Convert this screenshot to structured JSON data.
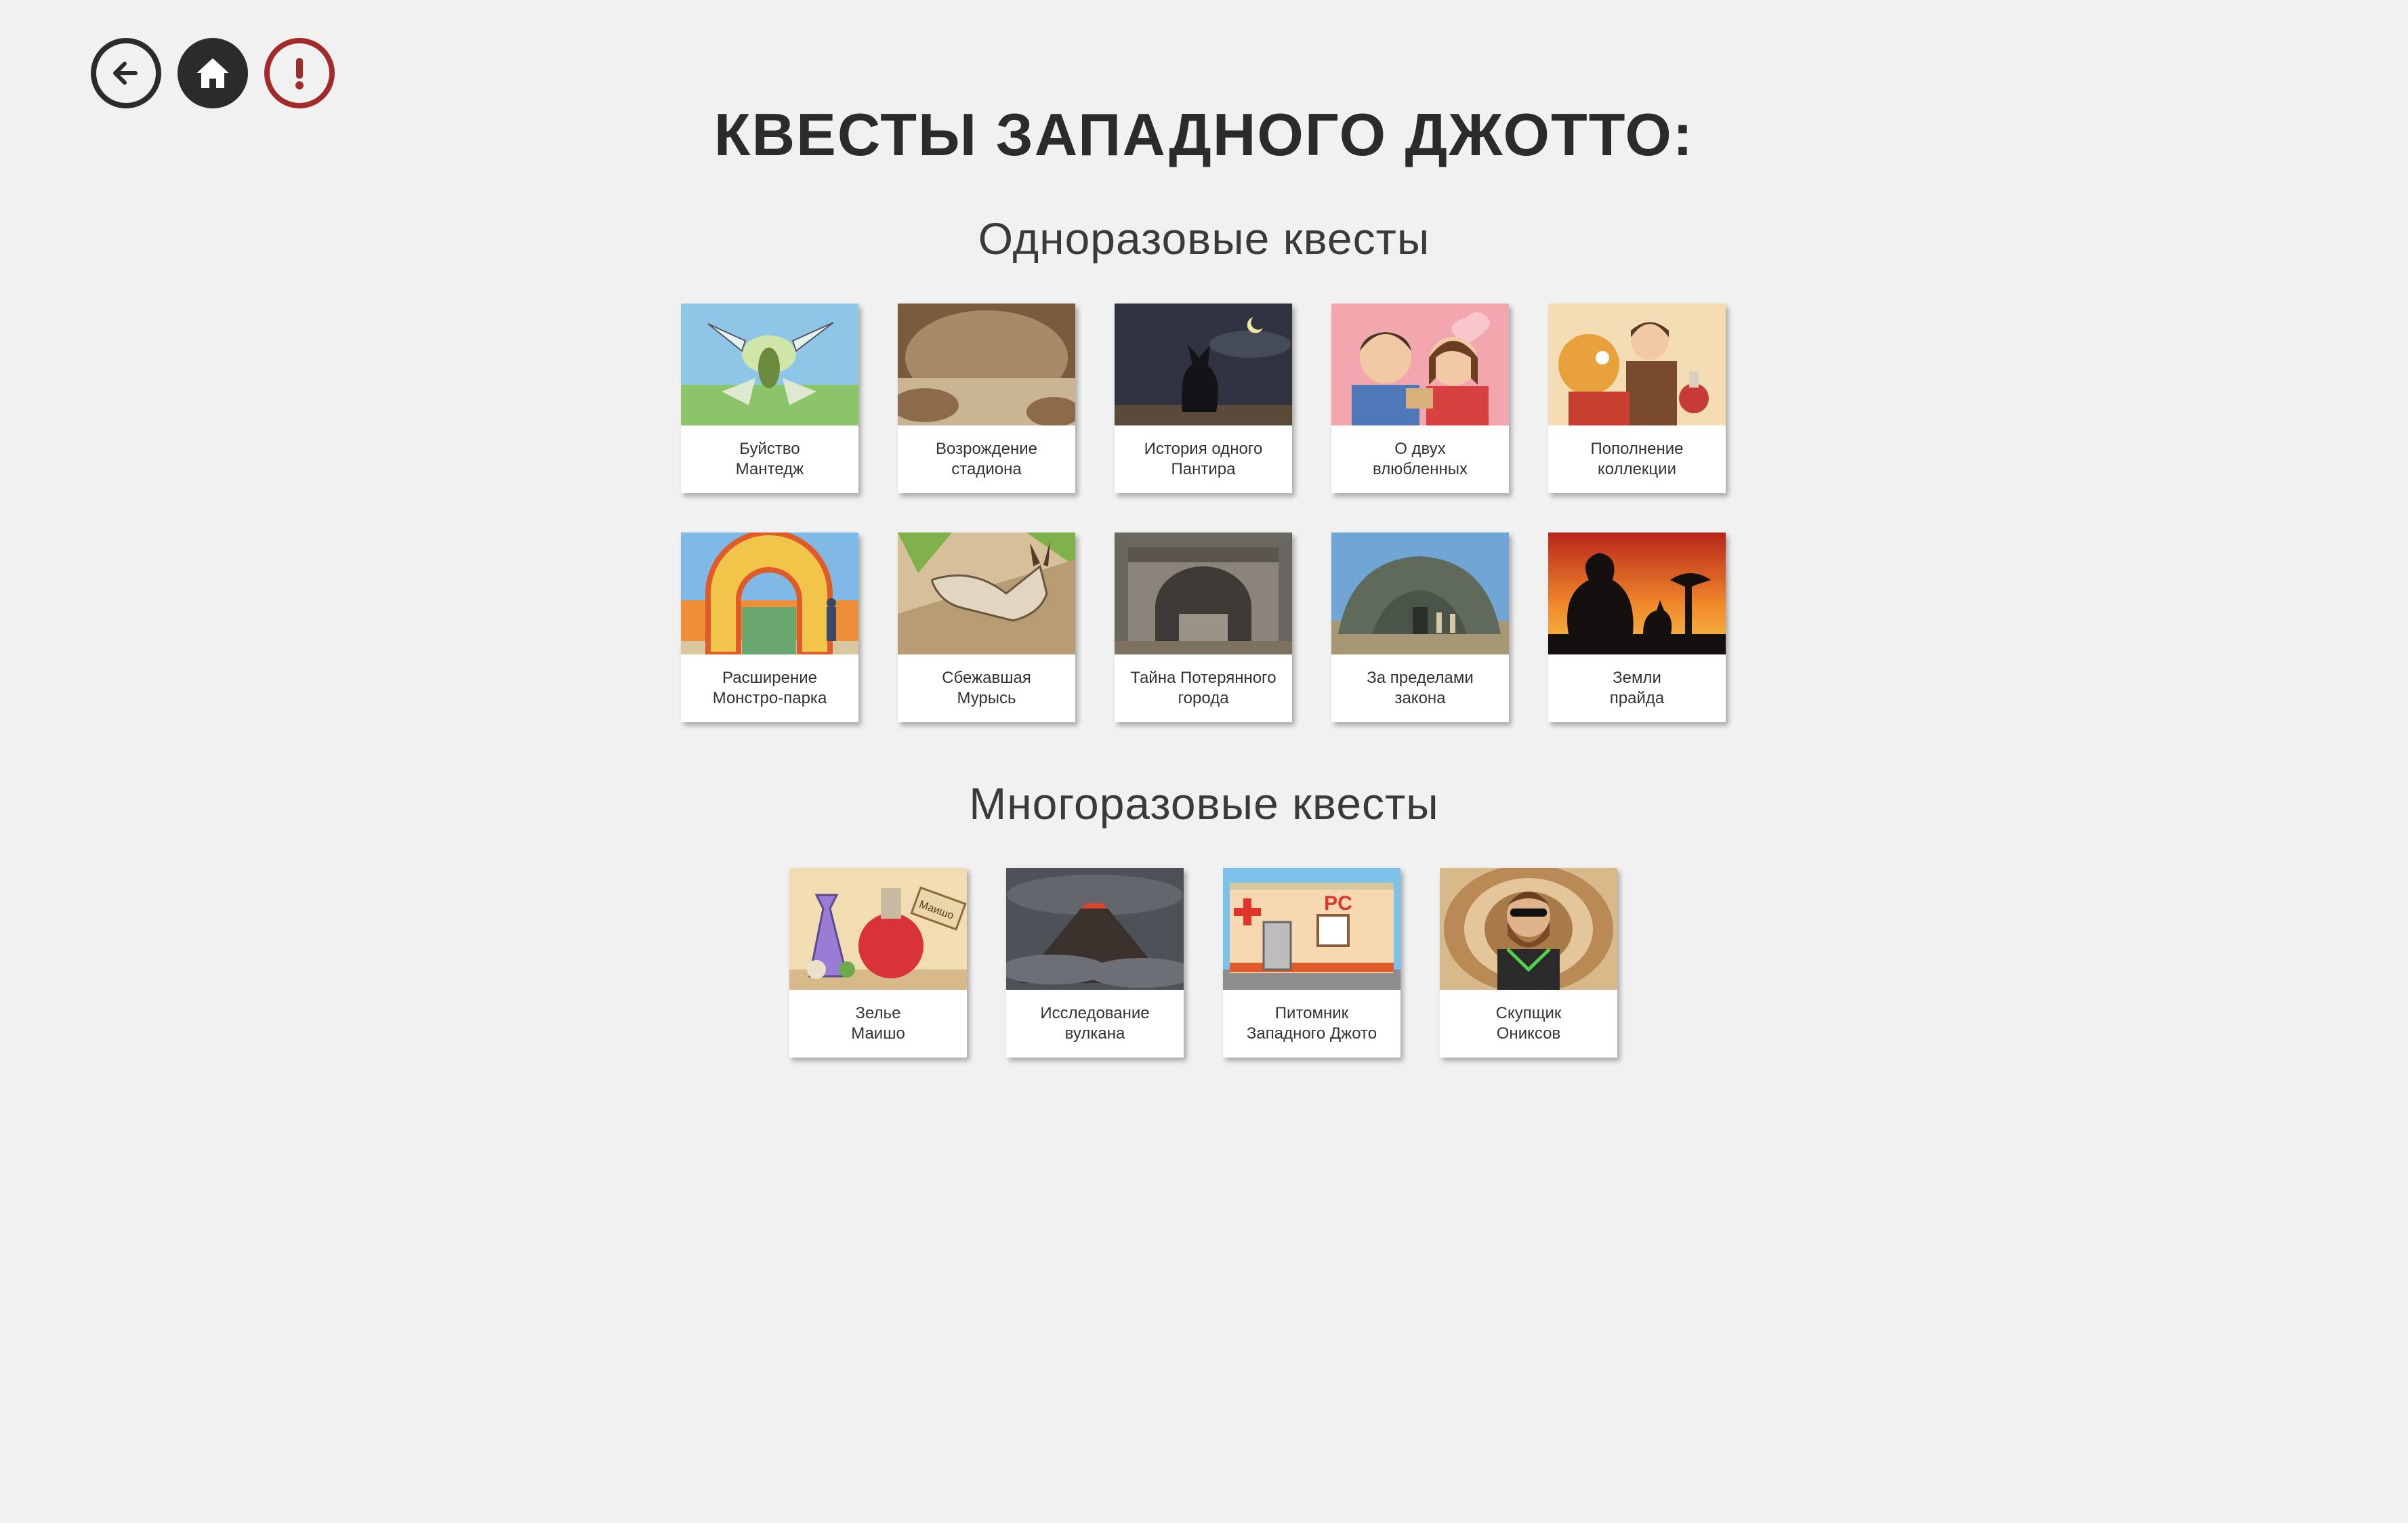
{
  "nav": {
    "back_icon": "arrow-left-icon",
    "home_icon": "home-icon",
    "alert_icon": "exclamation-icon",
    "alert_color": "#a22a2a"
  },
  "page": {
    "title": "КВЕСТЫ ЗАПАДНОГО ДЖОТТО:"
  },
  "sections": [
    {
      "title": "Одноразовые квесты",
      "cards": [
        {
          "line1": "Буйство",
          "line2": "Мантедж"
        },
        {
          "line1": "Возрождение",
          "line2": "стадиона"
        },
        {
          "line1": "История одного",
          "line2": "Пантира"
        },
        {
          "line1": "О двух",
          "line2": "влюбленных"
        },
        {
          "line1": "Пополнение",
          "line2": "коллекции"
        },
        {
          "line1": "Расширение",
          "line2": "Монстро-парка"
        },
        {
          "line1": "Сбежавшая",
          "line2": "Мурысь"
        },
        {
          "line1": "Тайна Потерянного",
          "line2": "города"
        },
        {
          "line1": "За пределами",
          "line2": "закона"
        },
        {
          "line1": "Земли",
          "line2": "прайда"
        }
      ]
    },
    {
      "title": "Многоразовые квесты",
      "cards": [
        {
          "line1": "Зелье",
          "line2": "Маишо"
        },
        {
          "line1": "Исследование",
          "line2": "вулкана"
        },
        {
          "line1": "Питомник",
          "line2": "Западного Джото"
        },
        {
          "line1": "Скупщик",
          "line2": "Ониксов"
        }
      ]
    }
  ],
  "thumb_text": {
    "pc_sign": "PC",
    "potion_tag": "Маишо"
  }
}
